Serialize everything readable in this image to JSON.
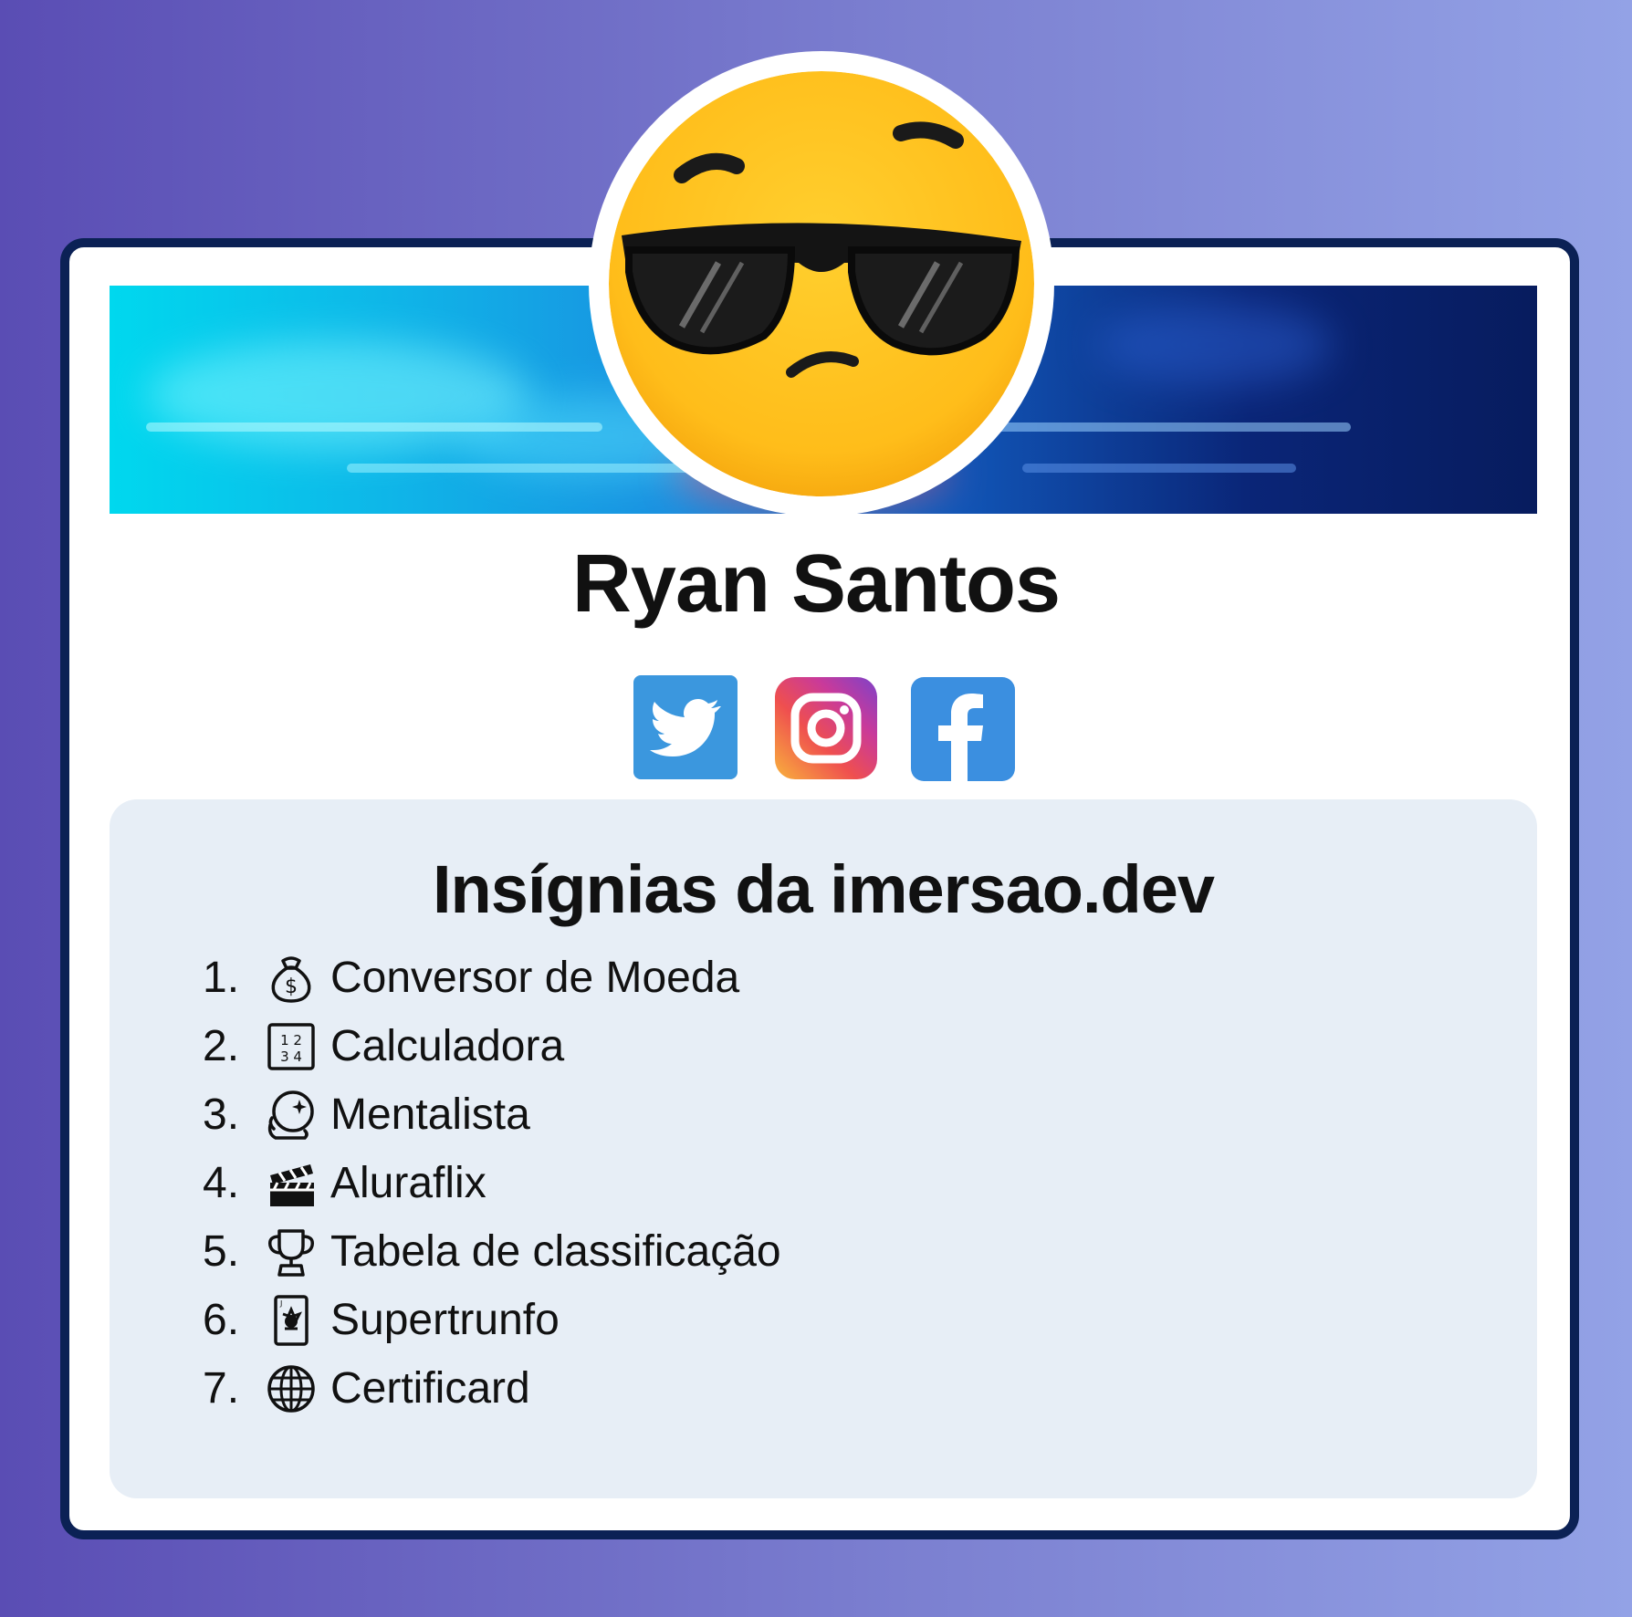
{
  "profile": {
    "name": "Ryan Santos"
  },
  "social": [
    {
      "network": "twitter",
      "icon": "twitter-icon",
      "color": "#3b97de"
    },
    {
      "network": "instagram",
      "icon": "instagram-icon",
      "color": "#d6397d"
    },
    {
      "network": "facebook",
      "icon": "facebook-icon",
      "color": "#3b8fe0"
    }
  ],
  "badges_section": {
    "title": "Insígnias da imersao.dev",
    "items": [
      {
        "number": "1.",
        "icon": "money-bag-icon",
        "label": "Conversor de Moeda"
      },
      {
        "number": "2.",
        "icon": "numbers-1234-icon",
        "label": "Calculadora"
      },
      {
        "number": "3.",
        "icon": "crystal-ball-icon",
        "label": "Mentalista"
      },
      {
        "number": "4.",
        "icon": "clapper-board-icon",
        "label": "Aluraflix"
      },
      {
        "number": "5.",
        "icon": "trophy-icon",
        "label": "Tabela de classificação"
      },
      {
        "number": "6.",
        "icon": "joker-card-icon",
        "label": "Supertrunfo"
      },
      {
        "number": "7.",
        "icon": "globe-icon",
        "label": "Certificard"
      }
    ]
  },
  "colors": {
    "card_border": "#0b2155",
    "panel_background": "#e7eef6",
    "avatar_yellow": "#ffc21a"
  }
}
